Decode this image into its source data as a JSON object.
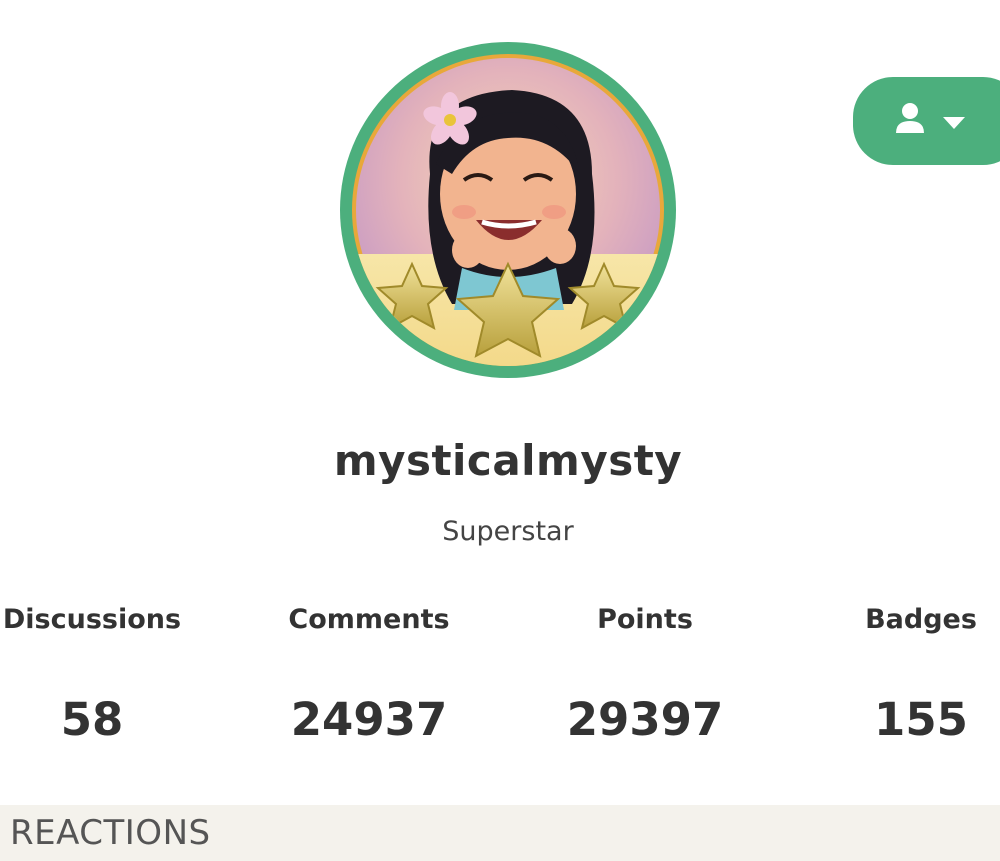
{
  "profile": {
    "username": "mysticalmysty",
    "rank": "Superstar",
    "avatar_alt": "avatar-image"
  },
  "options_button": {
    "icons": [
      "user-icon",
      "caret-down-icon"
    ]
  },
  "stats": [
    {
      "label": "Discussions",
      "value": "58"
    },
    {
      "label": "Comments",
      "value": "24937"
    },
    {
      "label": "Points",
      "value": "29397"
    },
    {
      "label": "Badges",
      "value": "155"
    }
  ],
  "sections": {
    "reactions_title": "REACTIONS"
  },
  "colors": {
    "accent": "#4caf7d",
    "avatar_rim": "#e8a83a",
    "section_bg": "#f4f2ec",
    "text": "#333333"
  }
}
